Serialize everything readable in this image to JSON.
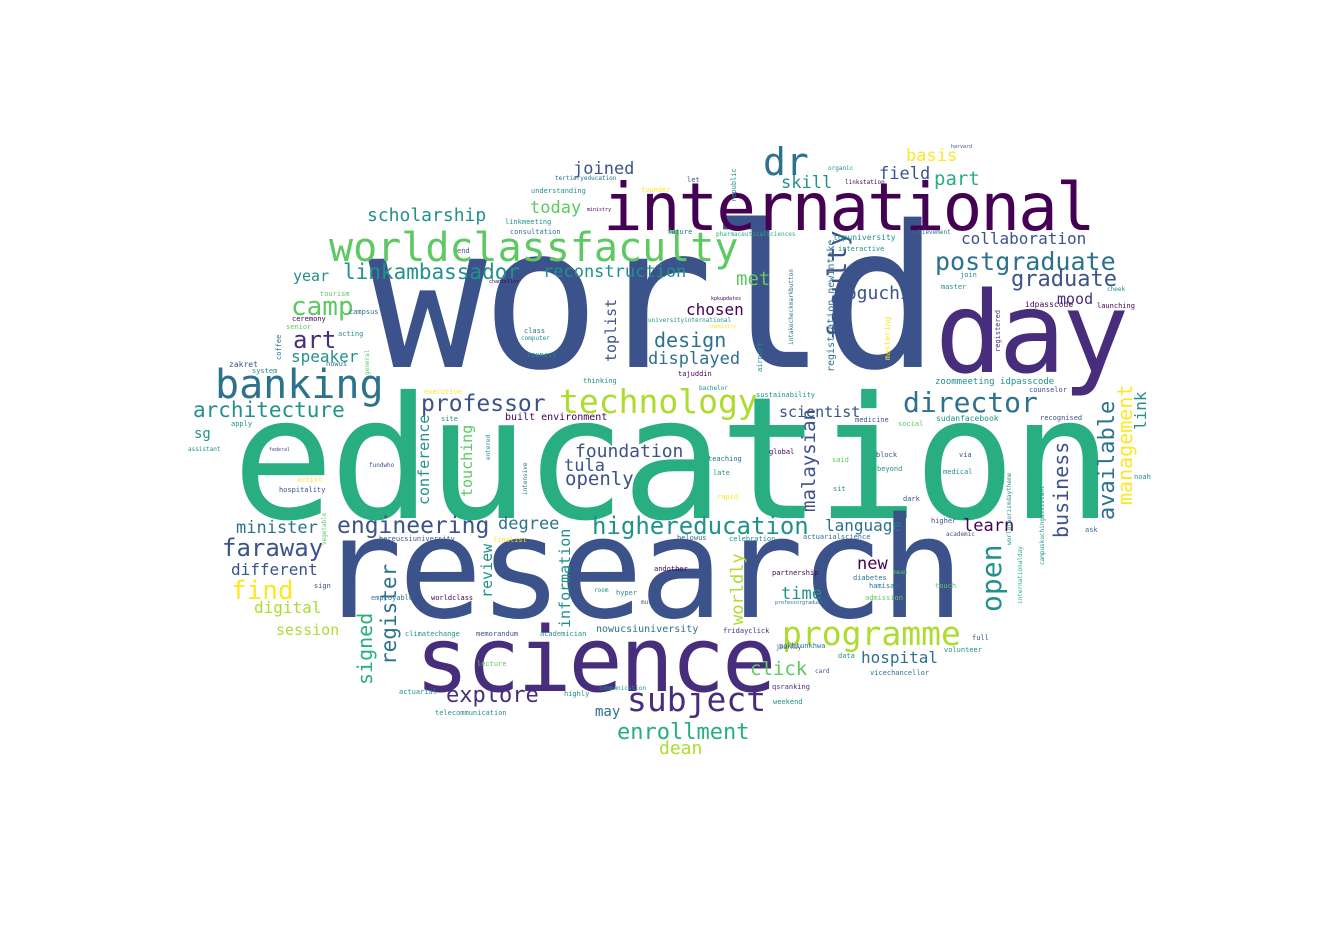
{
  "palette": {
    "dark_purple": "#440154",
    "purple": "#472d7b",
    "indigo": "#3b528b",
    "blue": "#2c728e",
    "teal": "#21918c",
    "green_teal": "#28ae80",
    "green": "#5ec962",
    "lime": "#addc30",
    "yellow": "#fde725"
  },
  "words": {
    "world": "world",
    "education": "education",
    "research": "research",
    "science": "science",
    "international": "international",
    "day": "day",
    "worldclassfaculty": "worldclassfaculty",
    "dr": "dr",
    "banking": "banking",
    "technology": "technology",
    "programme": "programme",
    "subject": "subject",
    "director": "director",
    "faculty": "faculty",
    "highereducation": "highereducation",
    "postgraduate": "postgraduate",
    "graduate": "graduate",
    "architecture": "architecture",
    "engineering": "engineering",
    "professor": "professor",
    "open": "open",
    "business": "business",
    "management": "management",
    "available": "available",
    "malaysian": "malaysian",
    "linkambassador": "linkambassador",
    "camp": "camp",
    "art": "art",
    "faraway": "faraway",
    "find": "find",
    "register": "register",
    "signed": "signed",
    "explore": "explore",
    "enrollment": "enrollment",
    "dean": "dean",
    "design": "design",
    "displayed": "displayed",
    "foundation": "foundation",
    "tula": "tula",
    "openly": "openly",
    "click": "click",
    "hospital": "hospital",
    "time": "time",
    "worldly": "worldly",
    "scholarship": "scholarship",
    "reconstruction": "reconstruction",
    "met": "met",
    "noguchi": "noguchi",
    "collaboration": "collaboration",
    "part": "part",
    "basis": "basis",
    "field": "field",
    "skill": "skill",
    "joined": "joined",
    "today": "today",
    "chosen": "chosen",
    "toplist": "toplist",
    "mood": "mood",
    "link": "link",
    "learn": "learn",
    "language": "language",
    "new": "new",
    "degree": "degree",
    "review": "review",
    "information": "information",
    "conference": "conference",
    "touching": "touching",
    "minister": "minister",
    "different": "different",
    "digital": "digital",
    "session": "session",
    "speaker": "speaker",
    "year": "year",
    "sg": "sg",
    "scientist": "scientist",
    "registration newintake": "registration newintake",
    "may": "may",
    "built environment": "built environment",
    "nowucsiuniversity": "nowucsiuniversity",
    "zoommeeting idpasscode": "zoommeeting idpasscode",
    "sudanfacebook": "sudanfacebook",
    "idpasscode": "idpasscode",
    "topuniversity": "topuniversity",
    "sustainability": "sustainability",
    "hereucsiuniversity": "hereucsiuniversity",
    "fridayclick": "fridayclick",
    "partnership": "partnership",
    "memorandum": "memorandum",
    "academician": "academician",
    "climatechange": "climatechange",
    "worldclass": "worldclass",
    "actuarial": "actuarial",
    "telecommunication": "telecommunication",
    "qsranking": "qsranking",
    "vicechancellor": "vicechancellor",
    "volunteer": "volunteer",
    "pakhtunkhwa": "pakhtunkhwa",
    "hospitality": "hospitality",
    "apply": "apply",
    "zakret": "zakret",
    "system": "system",
    "campsus": "campsus",
    "acting": "acting",
    "nowus": "nowus",
    "ceremony": "ceremony",
    "tourism": "tourism",
    "senior": "senior",
    "coffee": "coffee",
    "council": "council",
    "computer": "computer",
    "class": "class",
    "consultation": "consultation",
    "linkmeeting": "linkmeeting",
    "understanding": "understanding",
    "founder": "founder",
    "tertiaryeducation": "tertiaryeducation",
    "future": "future",
    "let": "let",
    "end": "end",
    "thinking": "thinking",
    "tajuddin": "tajuddin",
    "teaching": "teaching",
    "late": "late",
    "global": "global",
    "intensive": "intensive",
    "entered": "entered",
    "site": "site",
    "celebration": "celebration",
    "belowus": "belowus",
    "actuarialscience": "actuarialscience",
    "academic": "academic",
    "higher": "higher",
    "ask": "ask",
    "medical": "medical",
    "via": "via",
    "dark": "dark",
    "beyond": "beyond",
    "block": "block",
    "medicine": "medicine",
    "social": "social",
    "recognised": "recognised",
    "counselor": "counselor",
    "launching": "launching",
    "join": "join",
    "master": "master",
    "registered": "registered",
    "interactive": "interactive",
    "achievement": "achievement",
    "linkstation": "linkstation",
    "organic": "organic",
    "republic": "republic",
    "airport": "airport",
    "bachelor": "bachelor",
    "intakecheckmarkbutton": "intakecheckmarkbutton",
    "mastering": "mastering",
    "hyper": "hyper",
    "must": "must",
    "andother": "andother",
    "admission": "admission",
    "touch": "touch",
    "full": "full",
    "journey": "journey",
    "data": "data",
    "card": "card",
    "weekend": "weekend",
    "communication": "communication",
    "highly": "highly",
    "lecture": "lecture",
    "executive": "executive",
    "assistant": "assistant",
    "federal": "federal",
    "artist": "artist",
    "fundwho": "fundwho",
    "employable": "employable",
    "sign": "sign",
    "general": "general",
    "vegetable": "vegetable",
    "finalist": "finalist",
    "hamisah": "hamisah",
    "diabetes": "diabetes",
    "mean": "mean",
    "internationalday": "internationalday",
    "campuskuchingassistant": "campuskuchingassistant",
    "worldtourismdaytheme": "worldtourismdaytheme",
    "sit": "sit",
    "said": "said",
    "rapid": "rapid",
    "room": "room",
    "harvard": "harvard",
    "pharmaceuticalsciences": "pharmaceuticalsciences",
    "universityinternational": "universityinternational",
    "chemistry": "chemistry",
    "kpkupdates": "kpkupdates",
    "chancellor": "chancellor",
    "ministry": "ministry",
    "professorgraduate": "professorgraduate",
    "noah": "noah",
    "cheek": "cheek"
  }
}
